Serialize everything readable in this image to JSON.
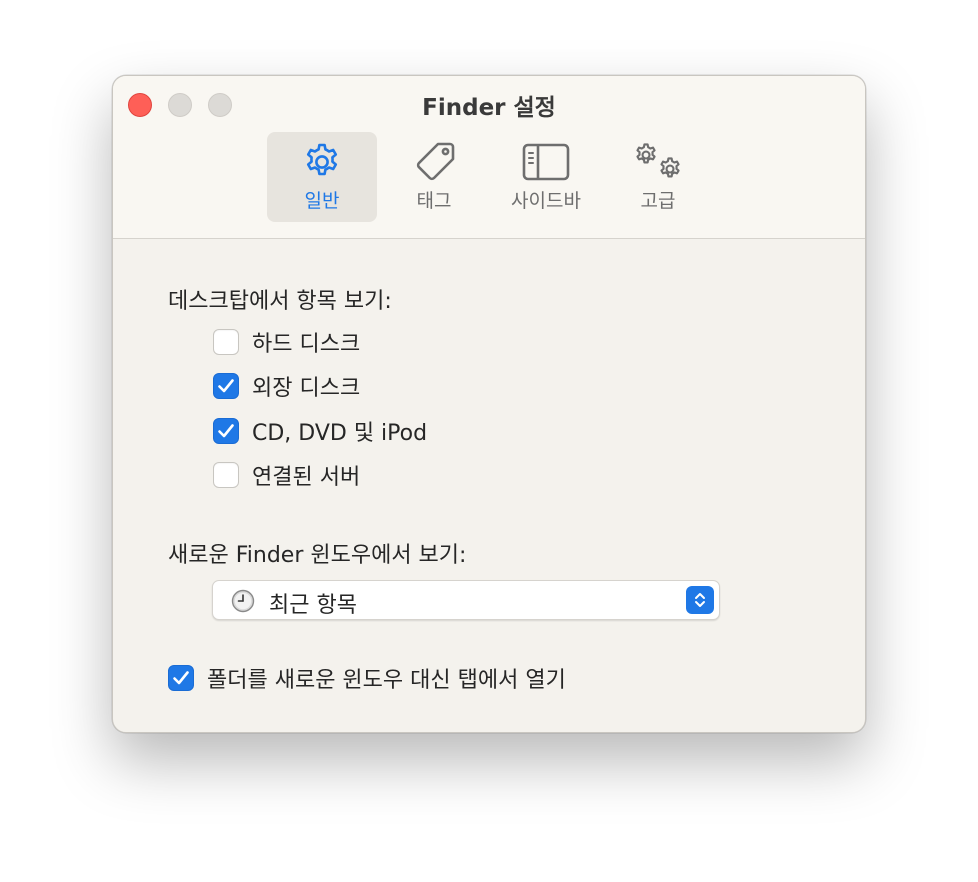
{
  "window": {
    "title": "Finder 설정"
  },
  "tabs": [
    {
      "label": "일반",
      "icon": "gear-icon",
      "selected": true
    },
    {
      "label": "태그",
      "icon": "tag-icon",
      "selected": false
    },
    {
      "label": "사이드바",
      "icon": "sidebar-icon",
      "selected": false
    },
    {
      "label": "고급",
      "icon": "gears-icon",
      "selected": false
    }
  ],
  "desktop_section": {
    "label": "데스크탑에서 항목 보기:",
    "items": [
      {
        "label": "하드 디스크",
        "checked": false
      },
      {
        "label": "외장 디스크",
        "checked": true
      },
      {
        "label": "CD, DVD 및 iPod",
        "checked": true
      },
      {
        "label": "연결된 서버",
        "checked": false
      }
    ]
  },
  "new_window_section": {
    "label": "새로운 Finder 윈도우에서 보기:",
    "selected_value": "최근 항목",
    "icon": "clock-icon"
  },
  "tabs_option": {
    "label": "폴더를 새로운 윈도우 대신 탭에서 열기",
    "checked": true
  },
  "colors": {
    "accent": "#1f78e6",
    "close": "#fe5f57"
  }
}
